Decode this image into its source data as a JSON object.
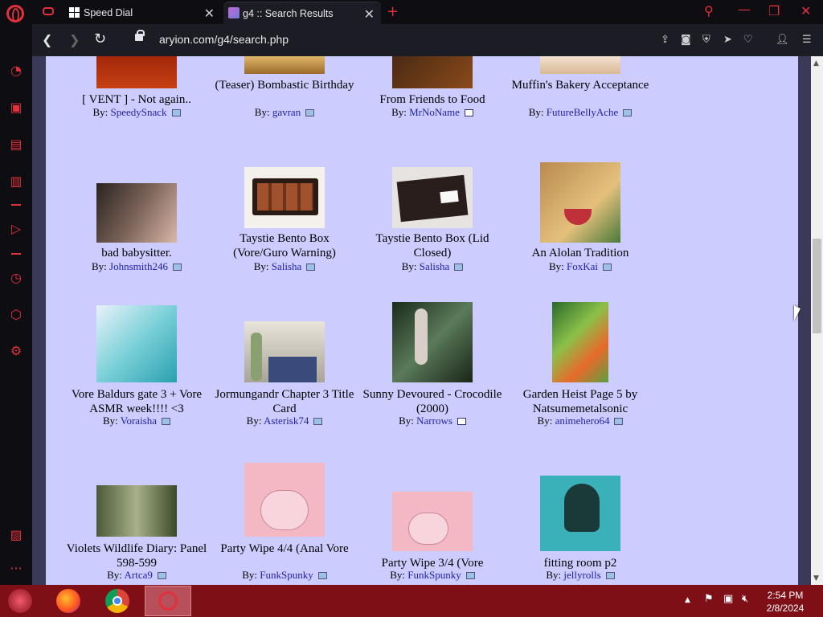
{
  "browser": {
    "tabs": [
      {
        "label": "Speed Dial",
        "favicon": "grid-icon"
      },
      {
        "label": "g4 :: Search Results",
        "favicon": "site-favicon"
      }
    ],
    "url": "aryion.com/g4/search.php",
    "accent": "#e0313d"
  },
  "gallery": {
    "by_prefix": "By:",
    "rows": [
      [
        {
          "title": "[ VENT ] - Not again..",
          "author": "SpeedySnack",
          "type": "image"
        },
        {
          "title": "(Teaser) Bombastic Birthday",
          "author": "gavran",
          "type": "image"
        },
        {
          "title": "From Friends to Food",
          "author": "MrNoName",
          "type": "text"
        },
        {
          "title": "Muffin's Bakery Acceptance",
          "author": "FutureBellyAche",
          "type": "image"
        }
      ],
      [
        {
          "title": "bad babysitter.",
          "author": "Johnsmith246",
          "type": "image"
        },
        {
          "title": "Taystie Bento Box (Vore/Guro Warning)",
          "author": "Salisha",
          "type": "image"
        },
        {
          "title": "Taystie Bento Box (Lid Closed)",
          "author": "Salisha",
          "type": "image"
        },
        {
          "title": "An Alolan Tradition",
          "author": "FoxKai",
          "type": "image"
        }
      ],
      [
        {
          "title": "Vore Baldurs gate 3 + Vore ASMR week!!!! <3",
          "author": "Voraisha",
          "type": "image"
        },
        {
          "title": "Jormungandr Chapter 3 Title Card",
          "author": "Asterisk74",
          "type": "image"
        },
        {
          "title": "Sunny Devoured - Crocodile (2000)",
          "author": "Narrows",
          "type": "text"
        },
        {
          "title": "Garden Heist Page 5 by Natsumemetalsonic",
          "author": "animehero64",
          "type": "image"
        }
      ],
      [
        {
          "title": "Violets Wildlife Diary: Panel 598-599",
          "author": "Artca9",
          "type": "image"
        },
        {
          "title": "Party Wipe 4/4 (Anal Vore",
          "author": "FunkSpunky",
          "type": "image"
        },
        {
          "title": "Party Wipe 3/4 (Vore",
          "author": "FunkSpunky",
          "type": "image"
        },
        {
          "title": "fitting room p2",
          "author": "jellyrolls",
          "type": "image"
        }
      ]
    ]
  },
  "taskbar": {
    "time": "2:54 PM",
    "date": "2/8/2024"
  }
}
